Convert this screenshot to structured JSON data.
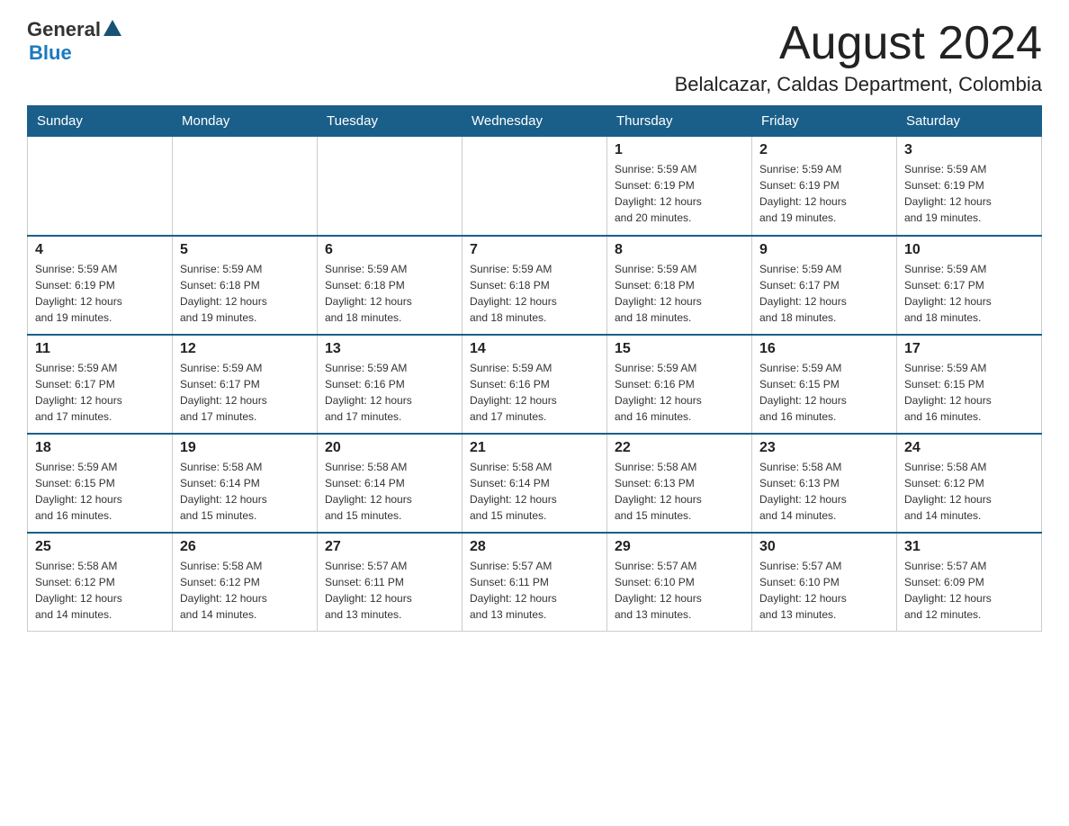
{
  "header": {
    "logo_general": "General",
    "logo_blue": "Blue",
    "month_title": "August 2024",
    "location": "Belalcazar, Caldas Department, Colombia"
  },
  "days_of_week": [
    "Sunday",
    "Monday",
    "Tuesday",
    "Wednesday",
    "Thursday",
    "Friday",
    "Saturday"
  ],
  "weeks": [
    [
      {
        "day": "",
        "info": ""
      },
      {
        "day": "",
        "info": ""
      },
      {
        "day": "",
        "info": ""
      },
      {
        "day": "",
        "info": ""
      },
      {
        "day": "1",
        "info": "Sunrise: 5:59 AM\nSunset: 6:19 PM\nDaylight: 12 hours\nand 20 minutes."
      },
      {
        "day": "2",
        "info": "Sunrise: 5:59 AM\nSunset: 6:19 PM\nDaylight: 12 hours\nand 19 minutes."
      },
      {
        "day": "3",
        "info": "Sunrise: 5:59 AM\nSunset: 6:19 PM\nDaylight: 12 hours\nand 19 minutes."
      }
    ],
    [
      {
        "day": "4",
        "info": "Sunrise: 5:59 AM\nSunset: 6:19 PM\nDaylight: 12 hours\nand 19 minutes."
      },
      {
        "day": "5",
        "info": "Sunrise: 5:59 AM\nSunset: 6:18 PM\nDaylight: 12 hours\nand 19 minutes."
      },
      {
        "day": "6",
        "info": "Sunrise: 5:59 AM\nSunset: 6:18 PM\nDaylight: 12 hours\nand 18 minutes."
      },
      {
        "day": "7",
        "info": "Sunrise: 5:59 AM\nSunset: 6:18 PM\nDaylight: 12 hours\nand 18 minutes."
      },
      {
        "day": "8",
        "info": "Sunrise: 5:59 AM\nSunset: 6:18 PM\nDaylight: 12 hours\nand 18 minutes."
      },
      {
        "day": "9",
        "info": "Sunrise: 5:59 AM\nSunset: 6:17 PM\nDaylight: 12 hours\nand 18 minutes."
      },
      {
        "day": "10",
        "info": "Sunrise: 5:59 AM\nSunset: 6:17 PM\nDaylight: 12 hours\nand 18 minutes."
      }
    ],
    [
      {
        "day": "11",
        "info": "Sunrise: 5:59 AM\nSunset: 6:17 PM\nDaylight: 12 hours\nand 17 minutes."
      },
      {
        "day": "12",
        "info": "Sunrise: 5:59 AM\nSunset: 6:17 PM\nDaylight: 12 hours\nand 17 minutes."
      },
      {
        "day": "13",
        "info": "Sunrise: 5:59 AM\nSunset: 6:16 PM\nDaylight: 12 hours\nand 17 minutes."
      },
      {
        "day": "14",
        "info": "Sunrise: 5:59 AM\nSunset: 6:16 PM\nDaylight: 12 hours\nand 17 minutes."
      },
      {
        "day": "15",
        "info": "Sunrise: 5:59 AM\nSunset: 6:16 PM\nDaylight: 12 hours\nand 16 minutes."
      },
      {
        "day": "16",
        "info": "Sunrise: 5:59 AM\nSunset: 6:15 PM\nDaylight: 12 hours\nand 16 minutes."
      },
      {
        "day": "17",
        "info": "Sunrise: 5:59 AM\nSunset: 6:15 PM\nDaylight: 12 hours\nand 16 minutes."
      }
    ],
    [
      {
        "day": "18",
        "info": "Sunrise: 5:59 AM\nSunset: 6:15 PM\nDaylight: 12 hours\nand 16 minutes."
      },
      {
        "day": "19",
        "info": "Sunrise: 5:58 AM\nSunset: 6:14 PM\nDaylight: 12 hours\nand 15 minutes."
      },
      {
        "day": "20",
        "info": "Sunrise: 5:58 AM\nSunset: 6:14 PM\nDaylight: 12 hours\nand 15 minutes."
      },
      {
        "day": "21",
        "info": "Sunrise: 5:58 AM\nSunset: 6:14 PM\nDaylight: 12 hours\nand 15 minutes."
      },
      {
        "day": "22",
        "info": "Sunrise: 5:58 AM\nSunset: 6:13 PM\nDaylight: 12 hours\nand 15 minutes."
      },
      {
        "day": "23",
        "info": "Sunrise: 5:58 AM\nSunset: 6:13 PM\nDaylight: 12 hours\nand 14 minutes."
      },
      {
        "day": "24",
        "info": "Sunrise: 5:58 AM\nSunset: 6:12 PM\nDaylight: 12 hours\nand 14 minutes."
      }
    ],
    [
      {
        "day": "25",
        "info": "Sunrise: 5:58 AM\nSunset: 6:12 PM\nDaylight: 12 hours\nand 14 minutes."
      },
      {
        "day": "26",
        "info": "Sunrise: 5:58 AM\nSunset: 6:12 PM\nDaylight: 12 hours\nand 14 minutes."
      },
      {
        "day": "27",
        "info": "Sunrise: 5:57 AM\nSunset: 6:11 PM\nDaylight: 12 hours\nand 13 minutes."
      },
      {
        "day": "28",
        "info": "Sunrise: 5:57 AM\nSunset: 6:11 PM\nDaylight: 12 hours\nand 13 minutes."
      },
      {
        "day": "29",
        "info": "Sunrise: 5:57 AM\nSunset: 6:10 PM\nDaylight: 12 hours\nand 13 minutes."
      },
      {
        "day": "30",
        "info": "Sunrise: 5:57 AM\nSunset: 6:10 PM\nDaylight: 12 hours\nand 13 minutes."
      },
      {
        "day": "31",
        "info": "Sunrise: 5:57 AM\nSunset: 6:09 PM\nDaylight: 12 hours\nand 12 minutes."
      }
    ]
  ]
}
